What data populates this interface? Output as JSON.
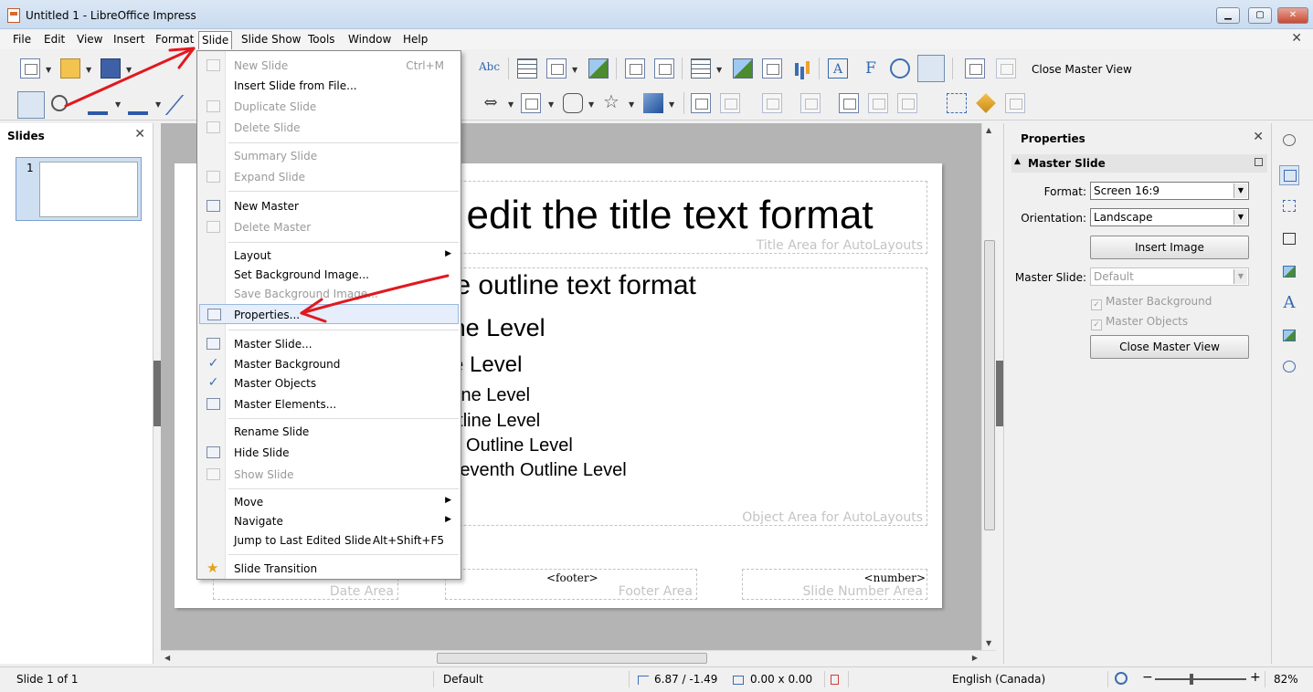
{
  "window": {
    "title": "Untitled 1 - LibreOffice Impress",
    "minimize": "▁",
    "maximize": "▢",
    "close": "✕"
  },
  "menubar": {
    "items": [
      "File",
      "Edit",
      "View",
      "Insert",
      "Format",
      "Slide",
      "Slide Show",
      "Tools",
      "Window",
      "Help"
    ],
    "open_menu": "Slide",
    "doc_close": "✕"
  },
  "toolbar": {
    "close_master_view": "Close Master View",
    "icons": [
      "new-icon",
      "open-folder-icon",
      "save-icon",
      "spellcheck-icon",
      "grid-icon",
      "display-views-icon",
      "image-effect-icon",
      "start-slideshow-icon",
      "table-icon",
      "image-icon",
      "media-icon",
      "chart-icon",
      "text-box-icon",
      "fontwork-icon",
      "hyperlink-icon",
      "master-slide-icon",
      "new-master-icon",
      "delete-master-icon",
      "select-icon",
      "zoom-icon",
      "line-color-icon",
      "fill-color-icon",
      "line-icon",
      "double-arrow-icon",
      "layout-icon",
      "callout-icon",
      "star-icon",
      "cube-icon",
      "points-icon",
      "align-icon",
      "arrange-icon",
      "distribute-icon",
      "shadow-icon",
      "crop-icon",
      "transformations-icon",
      "glue-icon",
      "extrusion-icon"
    ]
  },
  "slides_panel": {
    "title": "Slides",
    "close": "✕",
    "thumbnails": [
      {
        "number": "1"
      }
    ]
  },
  "slide_menu": {
    "items": [
      {
        "label": "New Slide",
        "shortcut": "Ctrl+M",
        "enabled": false,
        "icon": "new-slide-icon"
      },
      {
        "label": "Insert Slide from File...",
        "shortcut": "",
        "enabled": true,
        "icon": ""
      },
      {
        "label": "Duplicate Slide",
        "shortcut": "",
        "enabled": false,
        "icon": "duplicate-slide-icon"
      },
      {
        "label": "Delete Slide",
        "shortcut": "",
        "enabled": false,
        "icon": "delete-slide-icon"
      },
      {
        "label": "Summary Slide",
        "shortcut": "",
        "enabled": false,
        "icon": ""
      },
      {
        "label": "Expand Slide",
        "shortcut": "",
        "enabled": false,
        "icon": "expand-slide-icon"
      },
      {
        "label": "New Master",
        "shortcut": "",
        "enabled": true,
        "icon": "new-master-icon"
      },
      {
        "label": "Delete Master",
        "shortcut": "",
        "enabled": false,
        "icon": "delete-master-icon"
      },
      {
        "label": "Layout",
        "shortcut": "",
        "enabled": true,
        "icon": "",
        "submenu": true
      },
      {
        "label": "Set Background Image...",
        "shortcut": "",
        "enabled": true,
        "icon": ""
      },
      {
        "label": "Save Background Image...",
        "shortcut": "",
        "enabled": false,
        "icon": ""
      },
      {
        "label": "Properties...",
        "shortcut": "",
        "enabled": true,
        "icon": "properties-icon",
        "highlight": true
      },
      {
        "label": "Master Slide...",
        "shortcut": "",
        "enabled": true,
        "icon": "master-slide-icon"
      },
      {
        "label": "Master Background",
        "shortcut": "",
        "enabled": true,
        "icon": "check-icon"
      },
      {
        "label": "Master Objects",
        "shortcut": "",
        "enabled": true,
        "icon": "check-icon"
      },
      {
        "label": "Master Elements...",
        "shortcut": "",
        "enabled": true,
        "icon": "master-elements-icon"
      },
      {
        "label": "Rename Slide",
        "shortcut": "",
        "enabled": true,
        "icon": ""
      },
      {
        "label": "Hide Slide",
        "shortcut": "",
        "enabled": true,
        "icon": "hide-slide-icon"
      },
      {
        "label": "Show Slide",
        "shortcut": "",
        "enabled": false,
        "icon": "show-slide-icon"
      },
      {
        "label": "Move",
        "shortcut": "",
        "enabled": true,
        "icon": "",
        "submenu": true
      },
      {
        "label": "Navigate",
        "shortcut": "",
        "enabled": true,
        "icon": "",
        "submenu": true
      },
      {
        "label": "Jump to Last Edited Slide",
        "shortcut": "Alt+Shift+F5",
        "enabled": true,
        "icon": ""
      },
      {
        "label": "Slide Transition",
        "shortcut": "",
        "enabled": true,
        "icon": "slide-transition-icon"
      }
    ]
  },
  "slide": {
    "title_text": "Click to edit the title text format",
    "title_area_label": "Title Area for AutoLayouts",
    "outline": [
      {
        "text": "Click to edit the outline text format",
        "size": 30
      },
      {
        "text": "Second Outline Level",
        "size": 27
      },
      {
        "text": "Third Outline Level",
        "size": 24
      },
      {
        "text": "Fourth Outline Level",
        "size": 20
      },
      {
        "text": "Fifth Outline Level",
        "size": 20
      },
      {
        "text": "Sixth Outline Level",
        "size": 20
      },
      {
        "text": "Seventh Outline Level",
        "size": 20
      }
    ],
    "object_area_label": "Object Area for AutoLayouts",
    "date_area_label": "Date Area",
    "footer_text": "<footer>",
    "footer_area_label": "Footer Area",
    "number_text": "<number>",
    "number_area_label": "Slide Number Area"
  },
  "properties": {
    "title": "Properties",
    "close": "✕",
    "section": "Master Slide",
    "format_label": "Format:",
    "format_value": "Screen 16:9",
    "orientation_label": "Orientation:",
    "orientation_value": "Landscape",
    "insert_image": "Insert Image",
    "master_slide_label": "Master Slide:",
    "master_slide_value": "Default",
    "master_background": "Master Background",
    "master_objects": "Master Objects",
    "close_master_view": "Close Master View"
  },
  "sidebar_deck": {
    "icons": [
      "settings-icon",
      "properties-icon",
      "slide-transition-icon",
      "master-slides-icon",
      "custom-animation-icon",
      "styles-icon",
      "gallery-icon",
      "navigator-icon"
    ]
  },
  "statusbar": {
    "slide_info": "Slide 1 of 1",
    "master": "Default",
    "position": "6.87 / -1.49",
    "size": "0.00 x 0.00",
    "language": "English (Canada)",
    "zoom": "82%",
    "zoom_out": "−",
    "zoom_in": "+"
  },
  "colors": {
    "annotation_red": "#e0191f",
    "menu_highlight": "#e5eefa",
    "accent_blue": "#3b6db3"
  }
}
